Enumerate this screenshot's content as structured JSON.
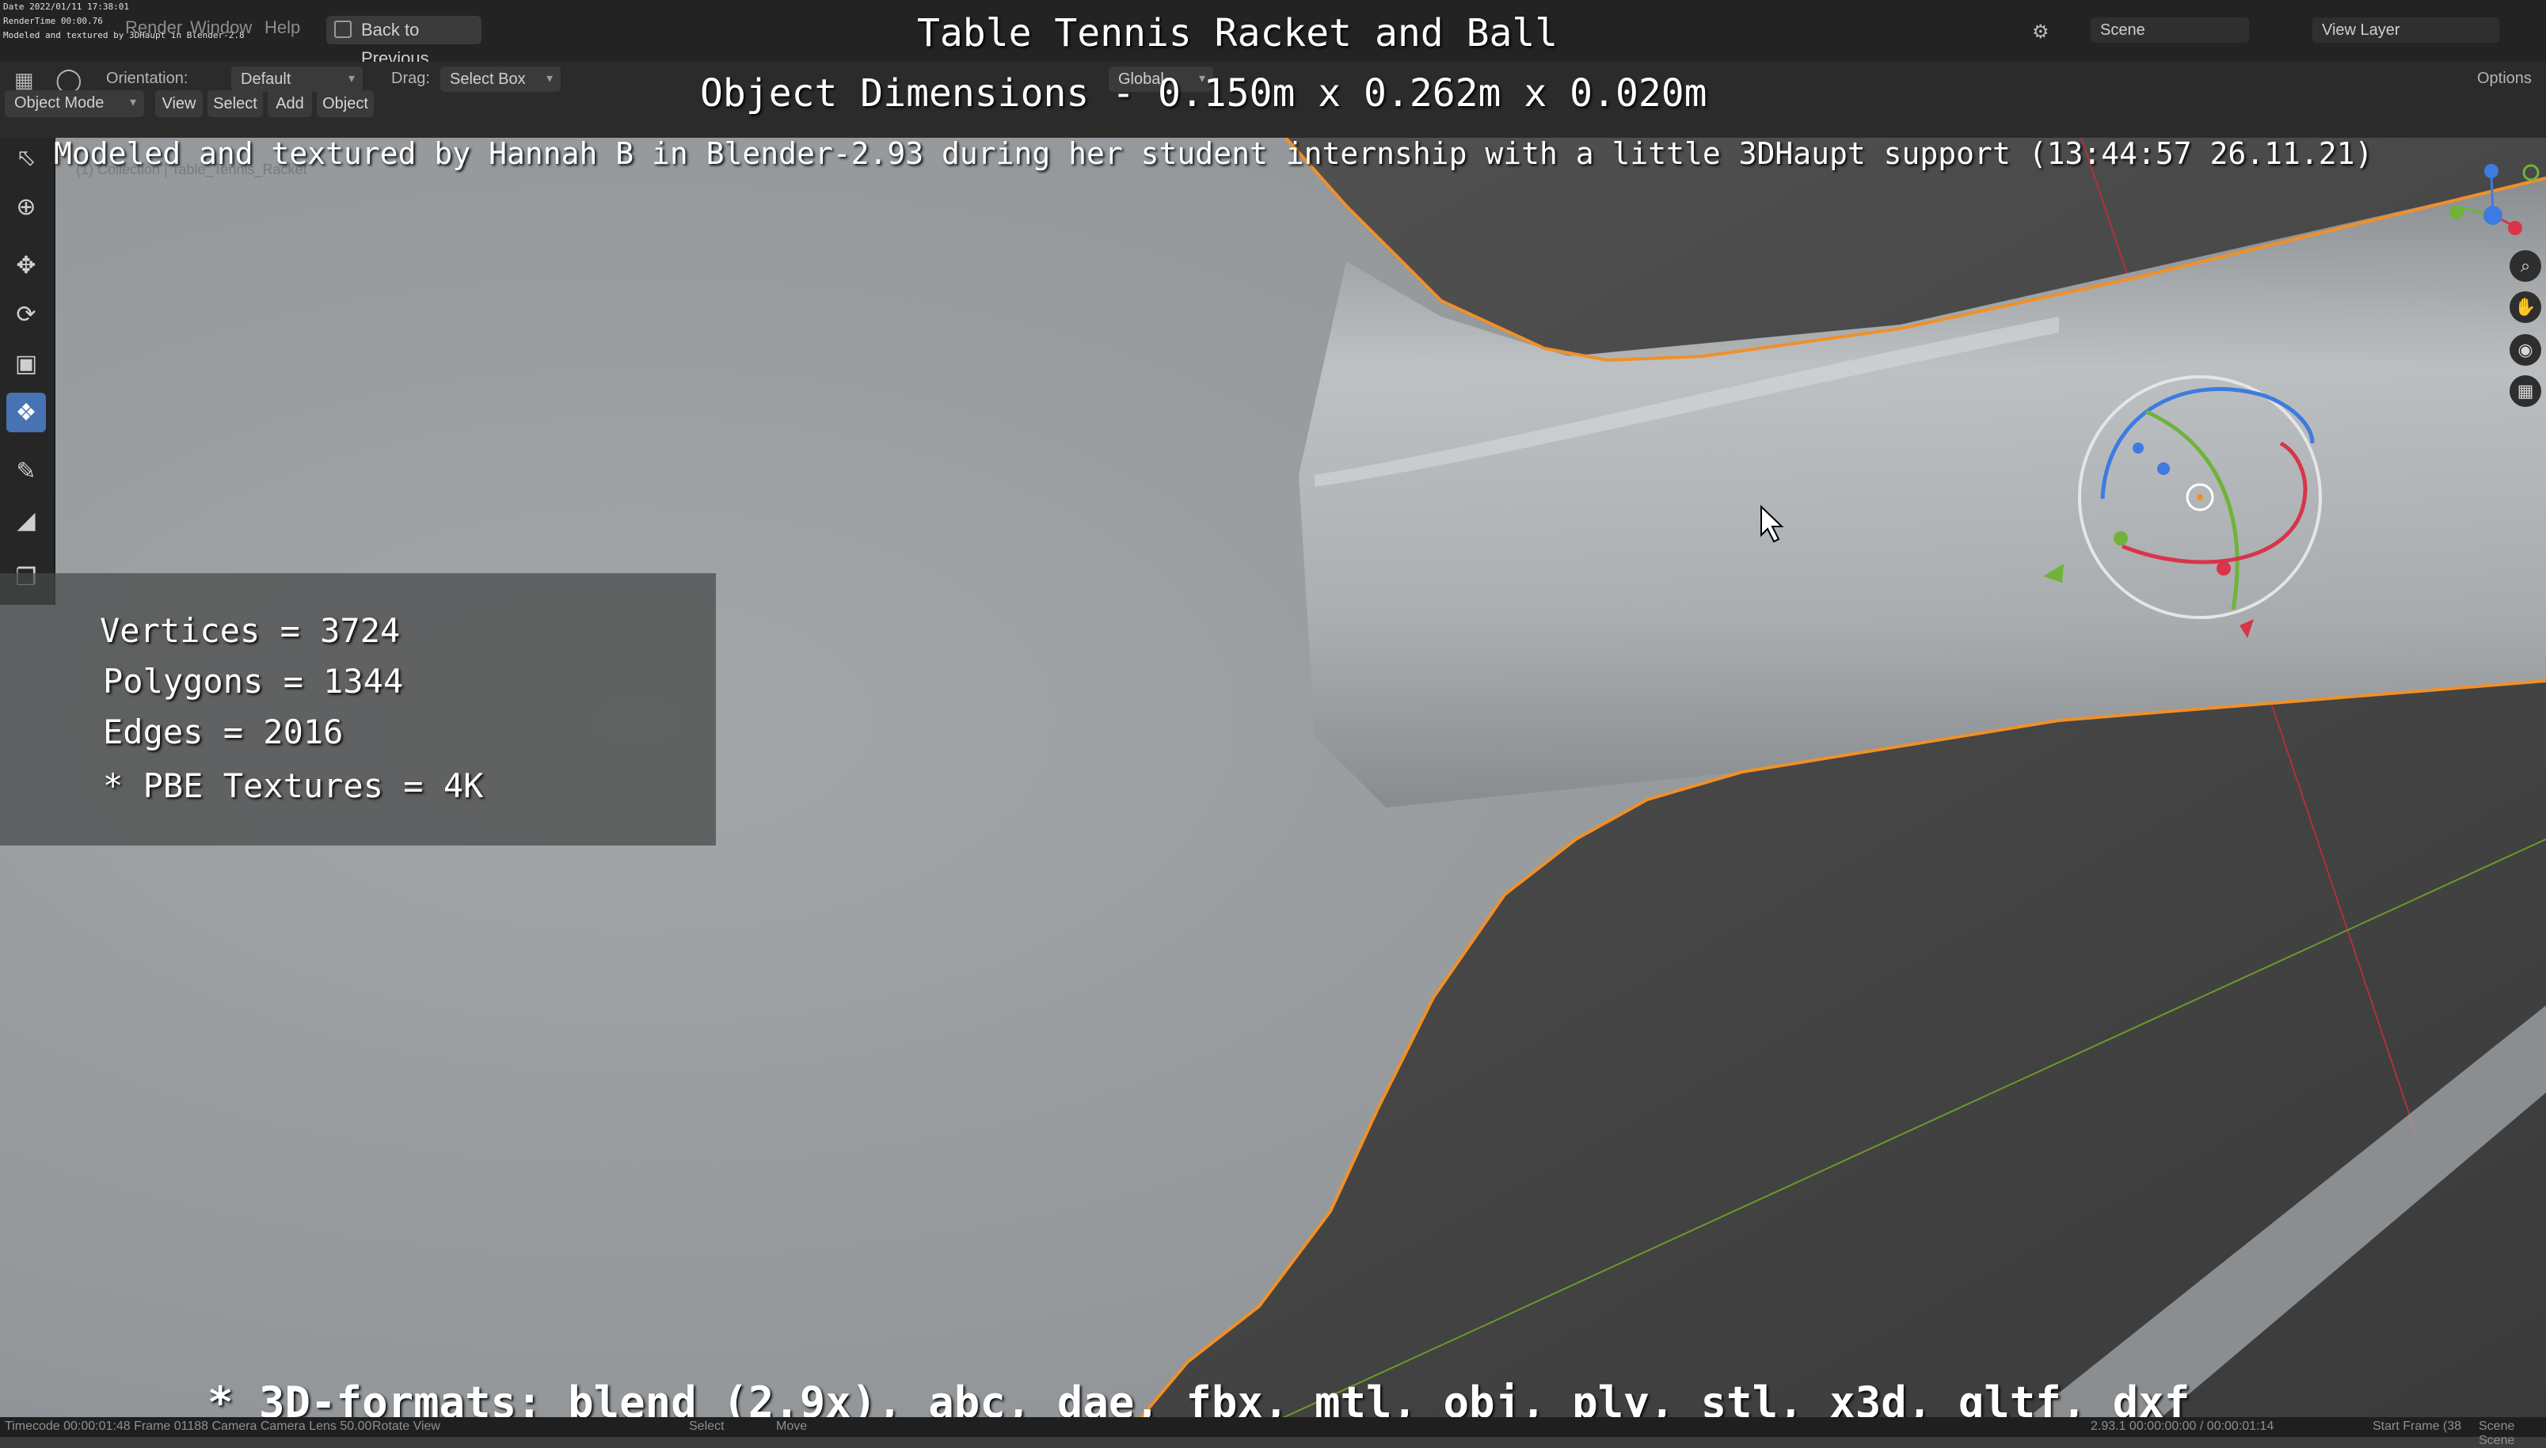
{
  "debug_info": {
    "date": "Date 2022/01/11 17:38:01",
    "rendertime": "RenderTime 00:00.76",
    "note": "Modeled and textured by 3DHaupt in Blender-2.8"
  },
  "topbar": {
    "menus": [
      "Render",
      "Window",
      "Help"
    ],
    "back_button": "Back to Previous",
    "scene_label": "Scene",
    "view_layer_label": "View Layer"
  },
  "header": {
    "orientation_label": "Orientation:",
    "orientation_value": "Default",
    "drag_label": "Drag:",
    "drag_value": "Select Box",
    "transform_orientation": "Global",
    "options_label": "Options",
    "mode": "Object Mode",
    "menus": [
      "View",
      "Select",
      "Add",
      "Object"
    ],
    "collection_path": "(1) Collection | Table_Tennis_Racket"
  },
  "overlay": {
    "title": "Table Tennis Racket and Ball",
    "dimensions": "Object Dimensions -  0.150m x 0.262m x 0.020m",
    "credits": "Modeled and textured by Hannah B in Blender-2.93 during her student internship with a little 3DHaupt support (13:44:57 26.11.21)",
    "formats": "* 3D-formats: blend (2.9x), abc, dae, fbx, mtl, obj, ply, stl, x3d, gltf, dxf"
  },
  "stats": {
    "vertices": "Vertices = 3724",
    "polygons": "Polygons = 1344",
    "edges": "Edges = 2016",
    "textures": "* PBE Textures = 4K"
  },
  "statusbar": {
    "left": "Timecode 00:00:01:48  Frame 01188  Camera Camera  Lens 50.00",
    "rotate": "Rotate View",
    "select": "Select",
    "move": "Move",
    "version": "2.93.1  00:00:00:00 / 00:00:01:14",
    "start_frame": "Start Frame (38",
    "scene": "Scene Scene"
  },
  "colors": {
    "selection_outline": "#f0902a",
    "x_axis": "#c03040",
    "y_axis": "#6b9a2a",
    "active_tool": "#4772b3"
  },
  "icons": [
    "select-box-icon",
    "cursor-icon",
    "move-icon",
    "rotate-icon",
    "scale-icon",
    "transform-icon",
    "annotate-icon",
    "measure-icon",
    "add-cube-icon",
    "zoom-icon",
    "hand-pan-icon",
    "camera-icon",
    "grid-icon",
    "cursor-arrow-icon"
  ]
}
